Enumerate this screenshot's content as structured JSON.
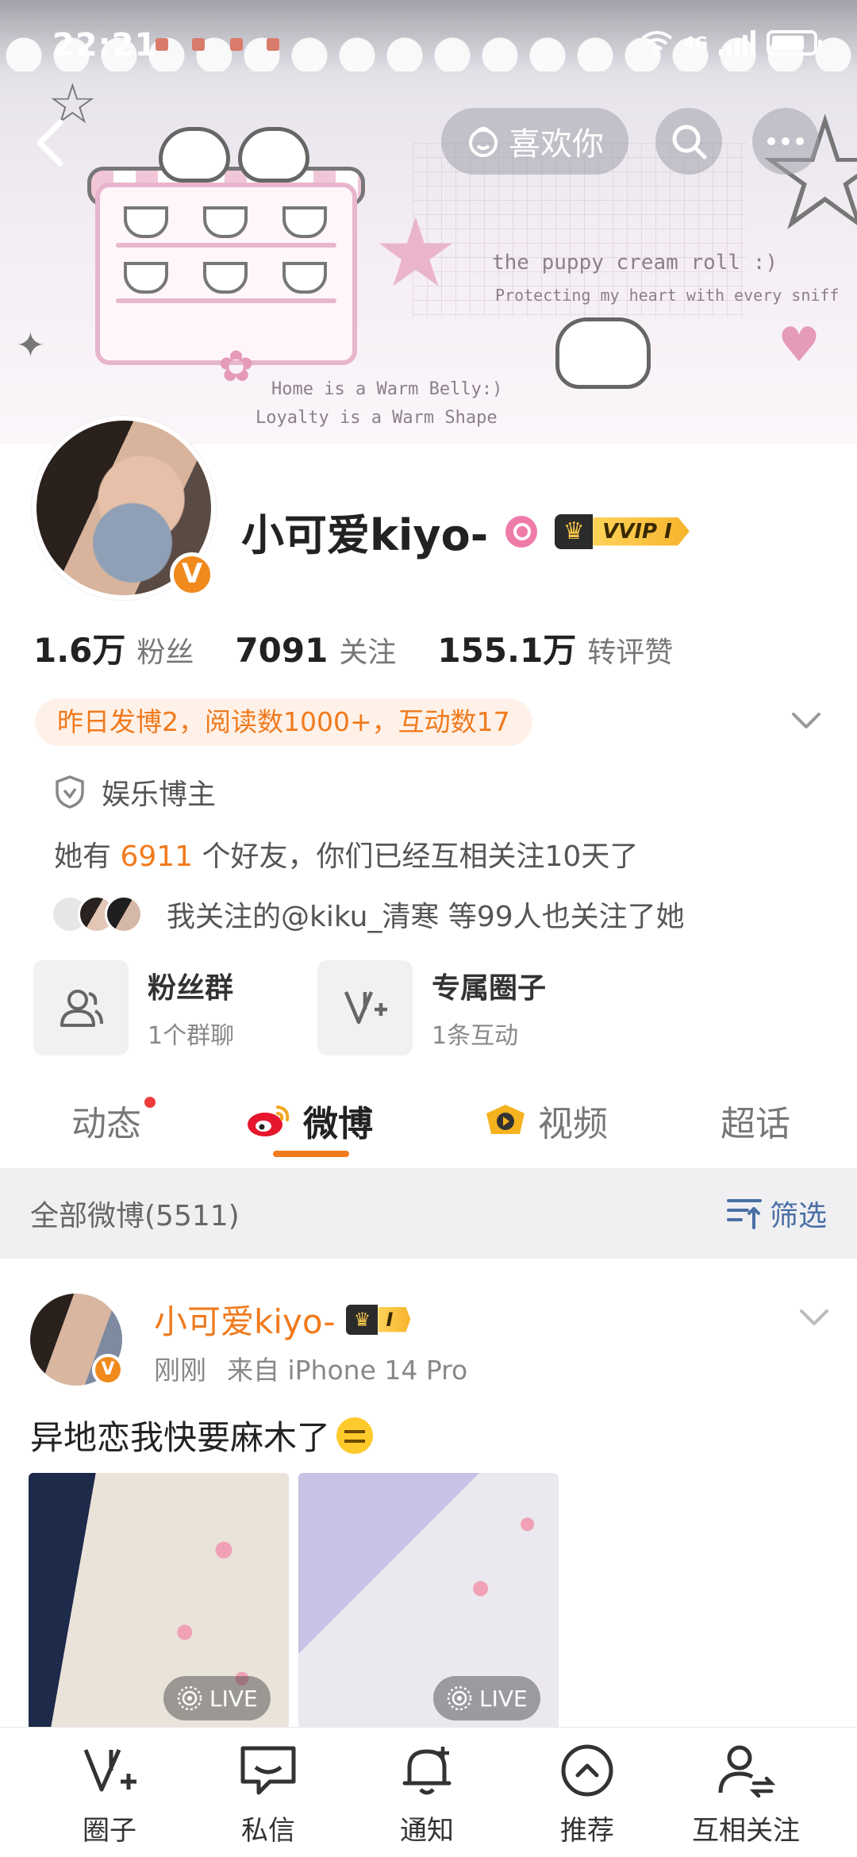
{
  "status_bar": {
    "time": "22:21",
    "network": "4G",
    "battery_level": 0.8
  },
  "header": {
    "like_button_label": "喜欢你",
    "decor_texts": [
      "the puppy cream roll :)",
      "Protecting my heart with every sniff",
      "Home is a Warm Belly:)",
      "Loyalty is a Warm Shape"
    ]
  },
  "profile": {
    "username": "小可爱kiyo-",
    "verified_badge": "V",
    "vip_label": "VVIP I",
    "stats": [
      {
        "value": "1.6万",
        "label": "粉丝"
      },
      {
        "value": "7091",
        "label": "关注"
      },
      {
        "value": "155.1万",
        "label": "转评赞"
      }
    ],
    "summary": "昨日发博2，阅读数1000+，互动数17",
    "role": "娱乐博主",
    "friend_prefix": "她有 ",
    "friend_count": "6911",
    "friend_suffix": " 个好友，你们已经互相关注10天了",
    "mutual_text": "我关注的@kiku_清寒 等99人也关注了她"
  },
  "groups": [
    {
      "title": "粉丝群",
      "subtitle": "1个群聊",
      "icon": "people-icon"
    },
    {
      "title": "专属圈子",
      "subtitle": "1条互动",
      "icon": "circle-v-icon"
    }
  ],
  "tabs": [
    {
      "label": "动态",
      "has_dot": true
    },
    {
      "label": "微博",
      "active": true
    },
    {
      "label": "视频"
    },
    {
      "label": "超话"
    }
  ],
  "filter_bar": {
    "count_label": "全部微博(5511)",
    "filter_label": "筛选"
  },
  "post": {
    "author": "小可爱kiyo-",
    "vip_label": "I",
    "time": "刚刚",
    "source": "来自 iPhone 14 Pro",
    "text": "异地恋我快要麻木了",
    "photos": [
      {
        "badge": "LIVE"
      },
      {
        "badge": "LIVE"
      }
    ]
  },
  "bottom_nav": [
    {
      "label": "圈子",
      "icon": "circle-v-plus-icon"
    },
    {
      "label": "私信",
      "icon": "chat-bubble-icon"
    },
    {
      "label": "通知",
      "icon": "bell-plus-icon"
    },
    {
      "label": "推荐",
      "icon": "chevron-up-circle-icon"
    },
    {
      "label": "互相关注",
      "icon": "person-arrows-icon"
    }
  ],
  "colors": {
    "accent_orange": "#f07a1d",
    "link_blue": "#4a6fa5",
    "vip_gold": "#f7b42c",
    "notification_red": "#ef3b3b"
  }
}
